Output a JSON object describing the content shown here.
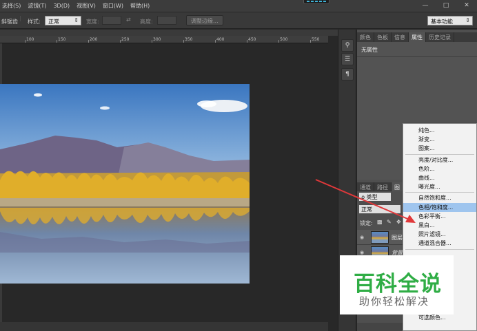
{
  "menubar": {
    "items": [
      "选择(S)",
      "滤镜(T)",
      "3D(D)",
      "视图(V)",
      "窗口(W)",
      "帮助(H)"
    ]
  },
  "window_controls": [
    "—",
    "□",
    "✕"
  ],
  "options_bar": {
    "feather_suffix": "斜锯齿",
    "style_label": "样式:",
    "style_value": "正常",
    "width_label": "宽度:",
    "height_label": "高度:",
    "refine_edge_button": "调整边缘...",
    "workspace_value": "基本功能"
  },
  "ruler": {
    "ticks": [
      "100",
      "150",
      "200",
      "250",
      "300",
      "350",
      "400",
      "450",
      "500",
      "550"
    ]
  },
  "right_panel": {
    "tabs": [
      "颜色",
      "色板",
      "信息",
      "属性",
      "历史记录"
    ],
    "active_tab": "属性",
    "properties_title": "无属性"
  },
  "layers_panel": {
    "tabs": [
      "通道",
      "路径",
      "图"
    ],
    "active_tab": "图",
    "kind_filter": "类型",
    "blend_mode": "正常",
    "lock_label": "锁定:",
    "layers": [
      {
        "name": "图层"
      },
      {
        "name": "背景"
      }
    ]
  },
  "adjustment_menu": {
    "items": [
      {
        "label": "纯色...",
        "group": 1
      },
      {
        "label": "渐变...",
        "group": 1
      },
      {
        "label": "图案...",
        "group": 1
      },
      {
        "label": "亮度/对比度...",
        "group": 2
      },
      {
        "label": "色阶...",
        "group": 2
      },
      {
        "label": "曲线...",
        "group": 2
      },
      {
        "label": "曝光度...",
        "group": 2
      },
      {
        "label": "自然饱和度...",
        "group": 3
      },
      {
        "label": "色相/饱和度...",
        "group": 3,
        "highlighted": true
      },
      {
        "label": "色彩平衡...",
        "group": 3
      },
      {
        "label": "黑白...",
        "group": 3
      },
      {
        "label": "照片滤镜...",
        "group": 3
      },
      {
        "label": "通道混合器...",
        "group": 3
      },
      {
        "label": "可选颜色...",
        "group": 4
      }
    ]
  },
  "watermark": {
    "logo": "百科全说",
    "tagline": "助你轻松解决",
    "color": "#2fad45"
  },
  "colors": {
    "highlight": "#9fc5ee",
    "arrow": "#e0383a"
  }
}
